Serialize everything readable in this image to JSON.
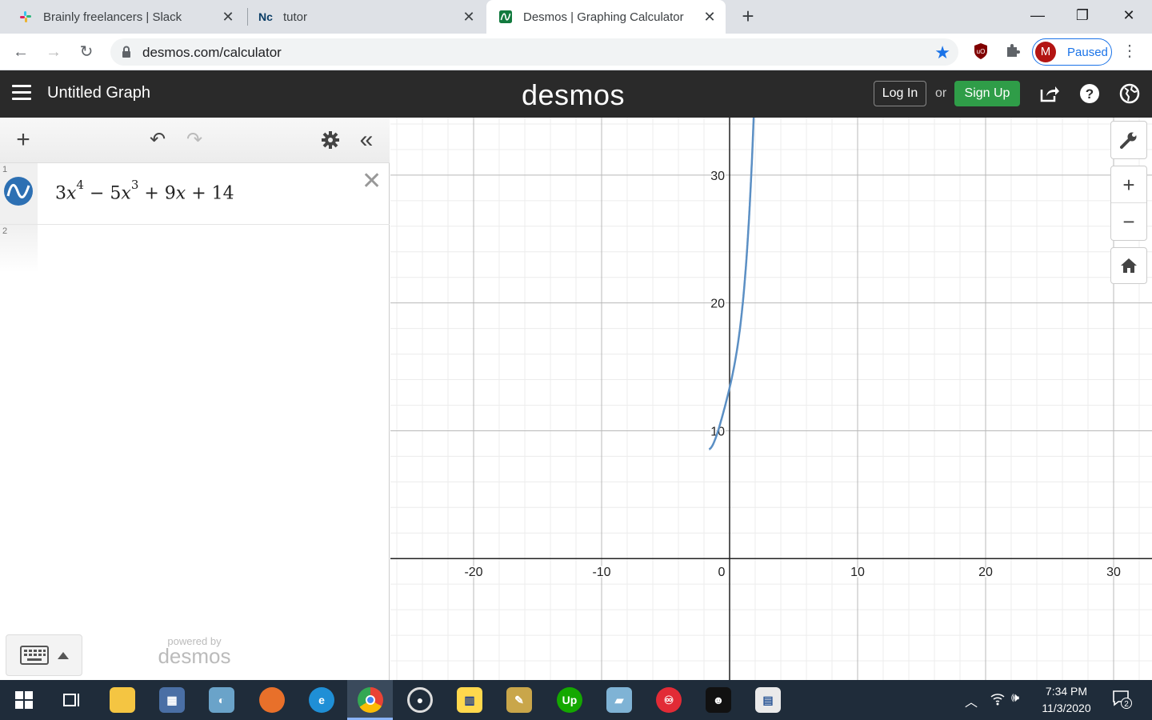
{
  "browser": {
    "tabs": [
      {
        "title": "Brainly freelancers | Slack",
        "icon": "slack-icon"
      },
      {
        "title": "tutor",
        "icon": "notion-icon"
      },
      {
        "title": "Desmos | Graphing Calculator",
        "icon": "desmos-icon",
        "active": true
      }
    ],
    "url": "desmos.com/calculator",
    "profile_initial": "M",
    "profile_status": "Paused"
  },
  "desmos": {
    "graph_title": "Untitled Graph",
    "logo": "desmos",
    "login_label": "Log In",
    "or_label": "or",
    "signup_label": "Sign Up",
    "expressions": [
      {
        "index": "1",
        "latex_display": "3x^4 - 5x^3 + 9x + 14"
      },
      {
        "index": "2",
        "latex_display": ""
      }
    ],
    "powered_by": "powered by",
    "powered_logo": "desmos",
    "accent": "#2f9d48",
    "curve_color": "#5b8fc4"
  },
  "chart_data": {
    "type": "line",
    "function": "3x^4 - 5x^3 + 9x + 14",
    "xlim": [
      -26.5,
      33
    ],
    "ylim": [
      -9.5,
      34.5
    ],
    "x_ticks": [
      -20,
      -10,
      0,
      10,
      20,
      30
    ],
    "y_ticks": [
      10,
      20,
      30
    ],
    "grid": true
  },
  "taskbar": {
    "time": "7:34 PM",
    "date": "11/3/2020",
    "notifications": "2"
  }
}
